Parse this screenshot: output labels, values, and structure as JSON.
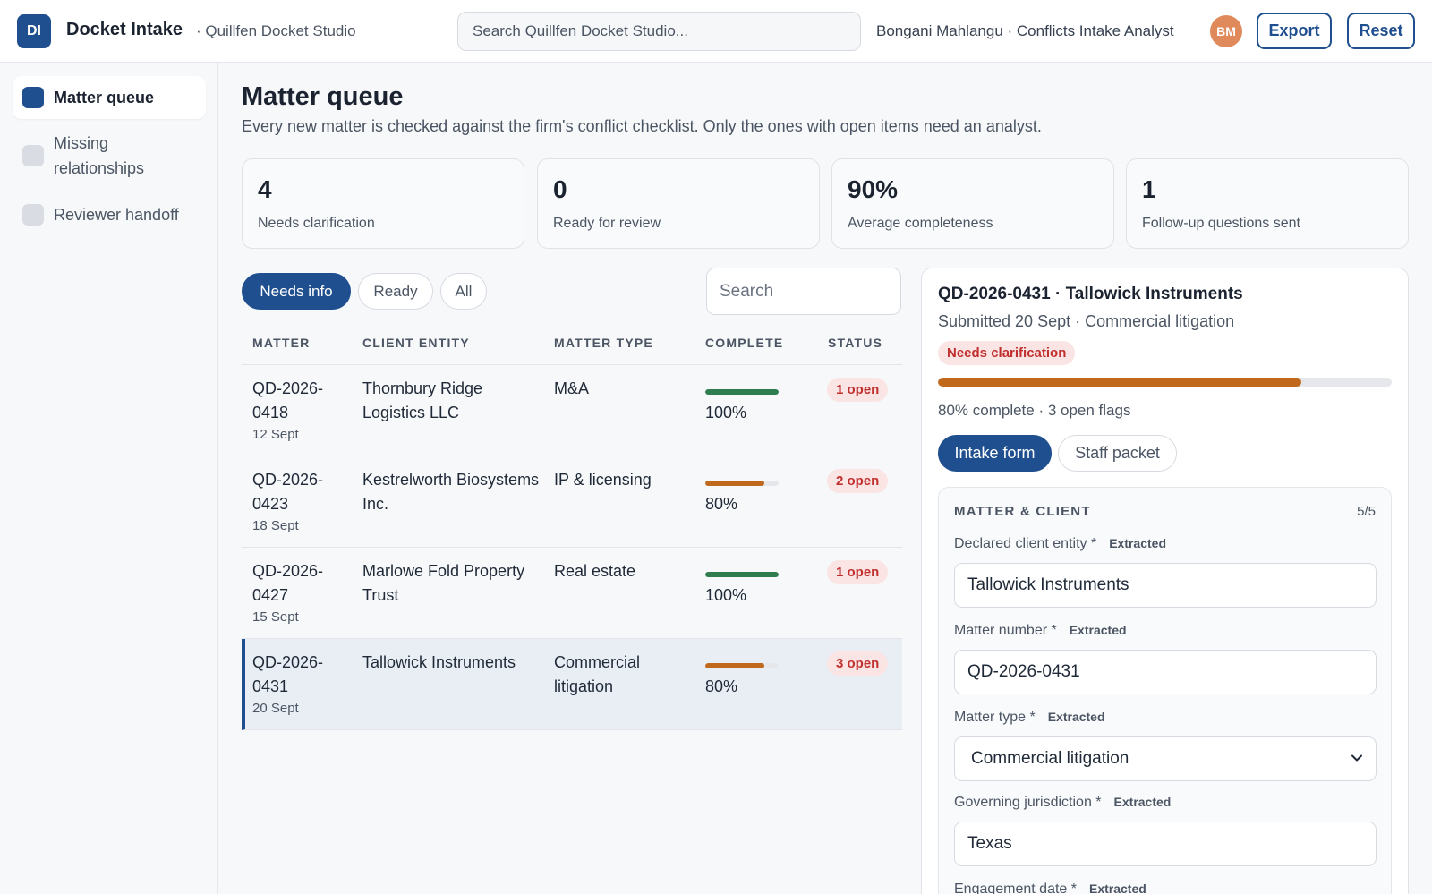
{
  "app": {
    "logo_initials": "DI",
    "title": "Docket Intake",
    "workspace": "· Quillfen Docket Studio",
    "search_placeholder": "Search Quillfen Docket Studio...",
    "user": "Bongani Mahlangu · Conflicts Intake Analyst",
    "user_initials": "BM",
    "export_label": "Export",
    "reset_label": "Reset"
  },
  "sidebar": {
    "items": [
      {
        "label": "Matter queue",
        "active": true
      },
      {
        "label": "Missing relationships",
        "active": false
      },
      {
        "label": "Reviewer handoff",
        "active": false
      }
    ]
  },
  "page": {
    "title": "Matter queue",
    "subtitle": "Every new matter is checked against the firm's conflict checklist. Only the ones with open items need an analyst."
  },
  "stats": [
    {
      "value": "4",
      "label": "Needs clarification"
    },
    {
      "value": "0",
      "label": "Ready for review"
    },
    {
      "value": "90%",
      "label": "Average completeness"
    },
    {
      "value": "1",
      "label": "Follow-up questions sent"
    }
  ],
  "filters": [
    {
      "label": "Needs info",
      "active": true
    },
    {
      "label": "Ready",
      "active": false
    },
    {
      "label": "All",
      "active": false
    }
  ],
  "table": {
    "search_placeholder": "Search",
    "columns": [
      "MATTER",
      "CLIENT ENTITY",
      "MATTER TYPE",
      "COMPLETE",
      "STATUS"
    ],
    "rows": [
      {
        "matter": "QD-2026-0418",
        "date": "12 Sept",
        "client": "Thornbury Ridge Logistics LLC",
        "type": "M&A",
        "complete": 100,
        "complete_label": "100%",
        "status": "1 open",
        "selected": false
      },
      {
        "matter": "QD-2026-0423",
        "date": "18 Sept",
        "client": "Kestrelworth Biosystems Inc.",
        "type": "IP & licensing",
        "complete": 80,
        "complete_label": "80%",
        "status": "2 open",
        "selected": false
      },
      {
        "matter": "QD-2026-0427",
        "date": "15 Sept",
        "client": "Marlowe Fold Property Trust",
        "type": "Real estate",
        "complete": 100,
        "complete_label": "100%",
        "status": "1 open",
        "selected": false
      },
      {
        "matter": "QD-2026-0431",
        "date": "20 Sept",
        "client": "Tallowick Instruments",
        "type": "Commercial litigation",
        "complete": 80,
        "complete_label": "80%",
        "status": "3 open",
        "selected": true
      }
    ]
  },
  "colors": {
    "brand": "#1f4f8f",
    "complete_bar": "#2f7d4f",
    "partial_bar": "#c0691c",
    "open_badge_bg": "#fbe4e4",
    "open_badge_text": "#c0302f"
  },
  "detail": {
    "title": "QD-2026-0431 · Tallowick Instruments",
    "subtitle": "Submitted 20 Sept · Commercial litigation",
    "badge": "Needs clarification",
    "progress": 80,
    "meta": "80% complete · 3 open flags",
    "tabs": [
      {
        "label": "Intake form",
        "active": true
      },
      {
        "label": "Staff packet",
        "active": false
      }
    ],
    "section": {
      "title": "MATTER & CLIENT",
      "count": "5/5",
      "fields": [
        {
          "label": "Declared client entity *",
          "tag": "Extracted",
          "value": "Tallowick Instruments",
          "kind": "input"
        },
        {
          "label": "Matter number *",
          "tag": "Extracted",
          "value": "QD-2026-0431",
          "kind": "input"
        },
        {
          "label": "Matter type *",
          "tag": "Extracted",
          "value": "Commercial litigation",
          "kind": "select"
        },
        {
          "label": "Governing jurisdiction *",
          "tag": "Extracted",
          "value": "Texas",
          "kind": "input"
        },
        {
          "label": "Engagement date *",
          "tag": "Extracted",
          "value": "",
          "kind": "input"
        }
      ]
    }
  }
}
